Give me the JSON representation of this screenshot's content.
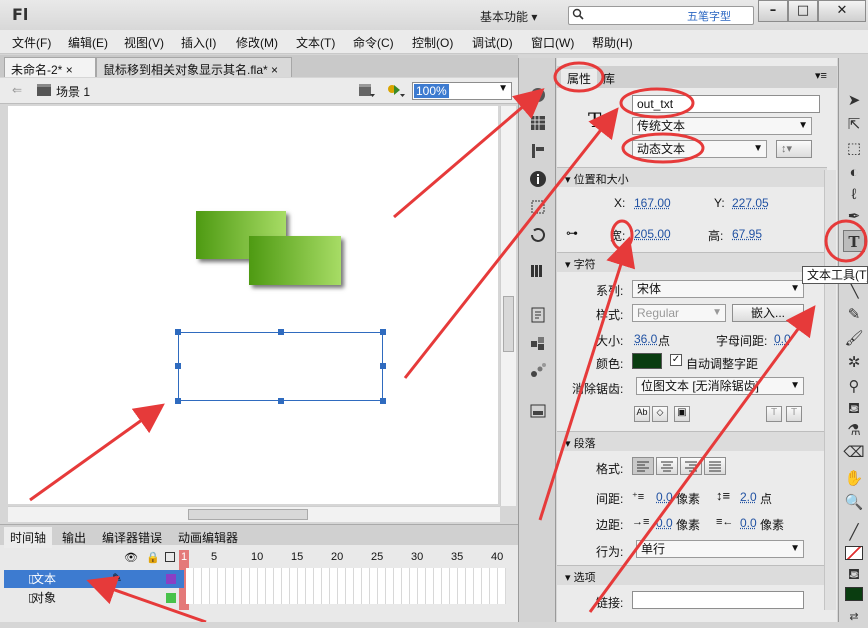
{
  "app": {
    "logo": "Fl",
    "workspace": "基本功能",
    "watermark_top": "五笔字型"
  },
  "window_buttons": {
    "minimize": "–",
    "maximize": "□",
    "close": "✕"
  },
  "menu": [
    "文件(F)",
    "编辑(E)",
    "视图(V)",
    "插入(I)",
    "修改(M)",
    "文本(T)",
    "命令(C)",
    "控制(O)",
    "调试(D)",
    "窗口(W)",
    "帮助(H)"
  ],
  "doc_tabs": [
    {
      "label": "未命名-2*",
      "close": "×"
    },
    {
      "label": "鼠标移到相关对象显示其名.fla*",
      "close": "×"
    }
  ],
  "scene": {
    "label": "场景 1",
    "zoom": "100%"
  },
  "timeline": {
    "tabs": [
      "时间轴",
      "输出",
      "编译器错误",
      "动画编辑器"
    ],
    "frame_numbers": [
      "1",
      "5",
      "10",
      "15",
      "20",
      "25",
      "30",
      "35",
      "40"
    ],
    "layers": [
      {
        "name": "文本",
        "selected": true
      },
      {
        "name": "对象",
        "selected": false
      }
    ]
  },
  "props": {
    "tabs": [
      "属性",
      "库"
    ],
    "instance_name": "out_txt",
    "text_engine": "传统文本",
    "text_type": "动态文本",
    "sections": {
      "position": "位置和大小",
      "character": "字符",
      "paragraph": "段落",
      "options": "选项"
    },
    "x_label": "X:",
    "x_value": "167.00",
    "y_label": "Y:",
    "y_value": "227.05",
    "w_label": "宽:",
    "w_value": "205.00",
    "h_label": "高:",
    "h_value": "67.95",
    "family_label": "系列:",
    "family_value": "宋体",
    "style_label": "样式:",
    "style_value": "Regular",
    "embed_label": "嵌入...",
    "size_label": "大小:",
    "size_value": "36.0",
    "size_unit": "点",
    "spacing_label": "字母间距:",
    "spacing_value": "0.0",
    "color_label": "颜色:",
    "color_value": "#0a3d10",
    "autokern_label": "自动调整字距",
    "aa_label": "消除锯齿:",
    "aa_value": "位图文本 [无消除锯齿]",
    "format_label": "格式:",
    "gap_label": "间距:",
    "gap_value1": "0.0",
    "gap_unit1": "像素",
    "gap_value2": "2.0",
    "gap_unit2": "点",
    "margin_label": "边距:",
    "margin_value1": "0.0",
    "margin_unit1": "像素",
    "margin_value2": "0.0",
    "margin_unit2": "像素",
    "behavior_label": "行为:",
    "behavior_value": "单行",
    "link_label": "链接:",
    "link_value": ""
  },
  "tooltip": "文本工具(T)",
  "colors": {
    "accent": "#2f6bbf",
    "annotation": "#e63a3a",
    "green_dark": "#4e9a12",
    "green_light": "#a7dc65"
  }
}
